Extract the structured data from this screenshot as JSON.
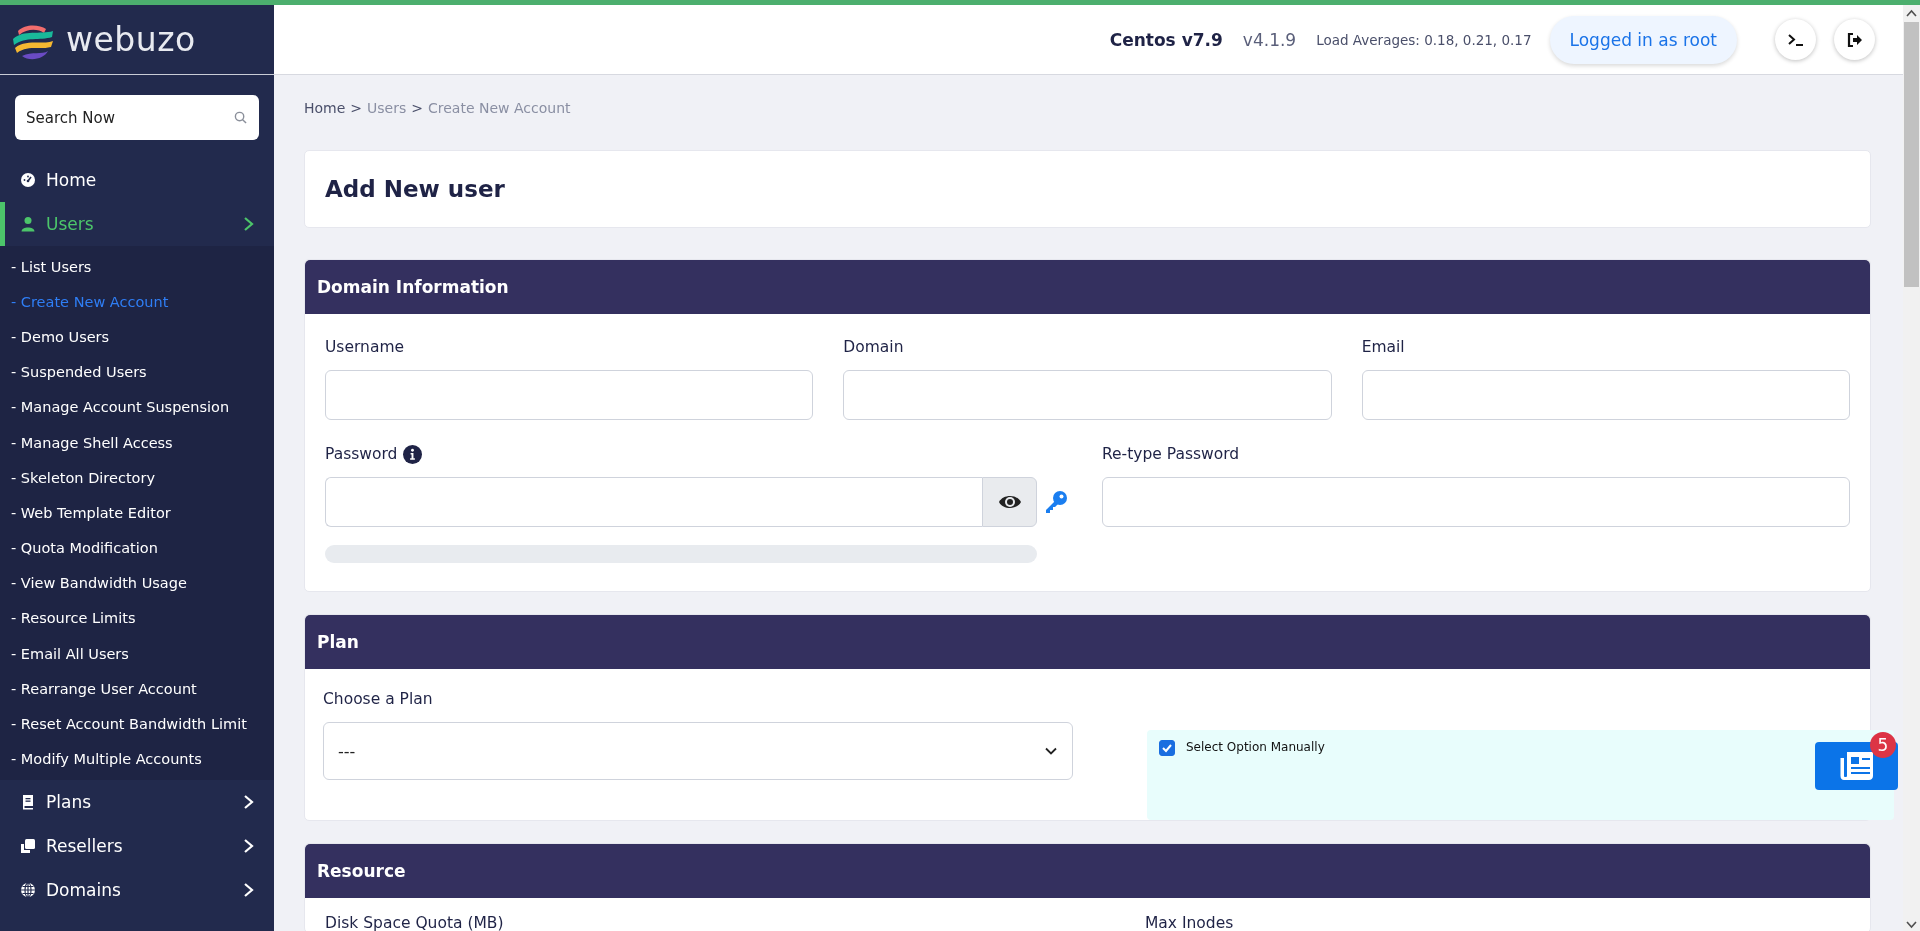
{
  "brand": {
    "name": "webuzo"
  },
  "sidebar": {
    "search": {
      "placeholder": "Search Now"
    },
    "items": [
      {
        "label": "Home",
        "kind": "link",
        "selected": false
      },
      {
        "label": "Users",
        "kind": "menu",
        "selected": true,
        "children": [
          {
            "label": "- List Users",
            "selected": false
          },
          {
            "label": "- Create New Account",
            "selected": true
          },
          {
            "label": "- Demo Users",
            "selected": false
          },
          {
            "label": "- Suspended Users",
            "selected": false
          },
          {
            "label": "- Manage Account Suspension",
            "selected": false
          },
          {
            "label": "- Manage Shell Access",
            "selected": false
          },
          {
            "label": "- Skeleton Directory",
            "selected": false
          },
          {
            "label": "- Web Template Editor",
            "selected": false
          },
          {
            "label": "- Quota Modification",
            "selected": false
          },
          {
            "label": "- View Bandwidth Usage",
            "selected": false
          },
          {
            "label": "- Resource Limits",
            "selected": false
          },
          {
            "label": "- Email All Users",
            "selected": false
          },
          {
            "label": "- Rearrange User Account",
            "selected": false
          },
          {
            "label": "- Reset Account Bandwidth Limit",
            "selected": false
          },
          {
            "label": "- Modify Multiple Accounts",
            "selected": false
          }
        ]
      },
      {
        "label": "Plans",
        "kind": "menu",
        "selected": false
      },
      {
        "label": "Resellers",
        "kind": "menu",
        "selected": false
      },
      {
        "label": "Domains",
        "kind": "menu",
        "selected": false
      }
    ]
  },
  "header": {
    "os": "Centos v7.9",
    "version": "v4.1.9",
    "load_averages": "Load Averages: 0.18, 0.21, 0.17",
    "user_button": "Logged in as root"
  },
  "breadcrumb": [
    {
      "kind": "link",
      "text": "Home"
    },
    {
      "kind": "separator",
      "text": ">"
    },
    {
      "kind": "link",
      "text": "Users"
    },
    {
      "kind": "separator",
      "text": ">"
    },
    {
      "kind": "current",
      "text": "Create New Account"
    }
  ],
  "page_title": "Add New user",
  "domain_information": {
    "title": "Domain Information",
    "fields": [
      {
        "label": "Username"
      },
      {
        "label": "Domain"
      },
      {
        "label": "Email"
      }
    ],
    "password": {
      "label": "Password",
      "level": 0
    },
    "retype_password": {
      "label": "Re-type Password"
    }
  },
  "plan": {
    "title": "Plan",
    "choose_label": "Choose a Plan",
    "select_value": "---",
    "manual_option": {
      "label": "Select Option Manually",
      "checked": true
    }
  },
  "resource": {
    "title": "Resource",
    "fields": [
      {
        "label": "Disk Space Quota (MB)"
      },
      {
        "label": "Max Inodes"
      }
    ]
  },
  "news_button": {
    "badge": "5"
  }
}
